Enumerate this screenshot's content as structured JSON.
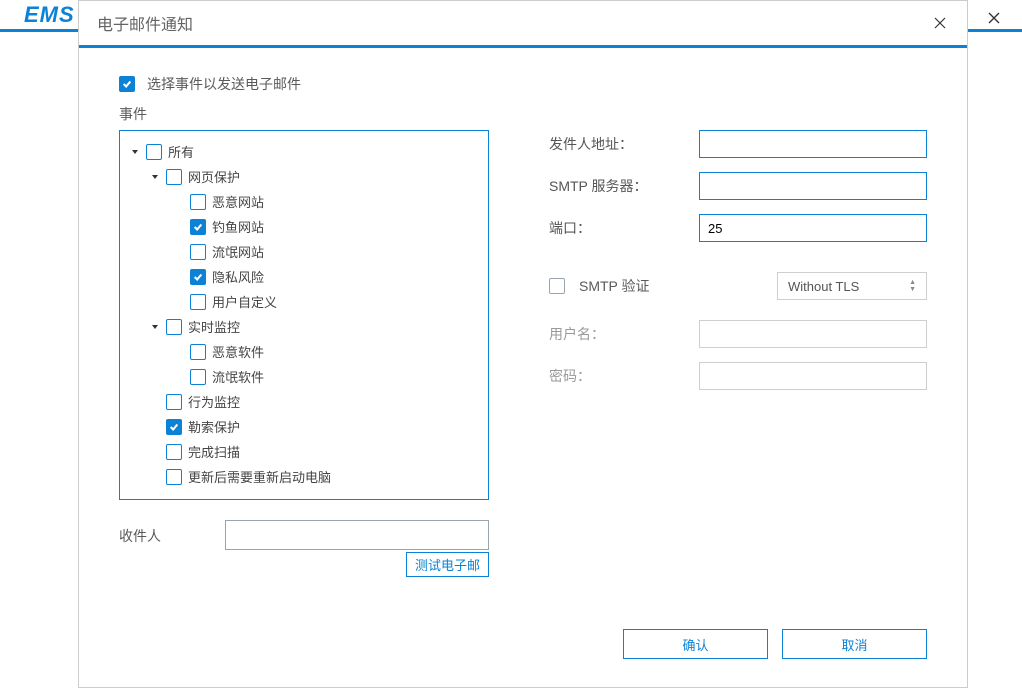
{
  "brand": "EMS",
  "modal": {
    "title": "电子邮件通知",
    "mainCheckbox": {
      "label": "选择事件以发送电子邮件",
      "checked": true
    },
    "eventsLabel": "事件",
    "tree": {
      "all": {
        "label": "所有",
        "checked": false
      },
      "webProtect": {
        "label": "网页保护",
        "checked": false
      },
      "badSite": {
        "label": "恶意网站",
        "checked": false
      },
      "phishing": {
        "label": "钓鱼网站",
        "checked": true
      },
      "rogueSite": {
        "label": "流氓网站",
        "checked": false
      },
      "privacy": {
        "label": "隐私风险",
        "checked": true
      },
      "userCustom": {
        "label": "用户自定义",
        "checked": false
      },
      "realtime": {
        "label": "实时监控",
        "checked": false
      },
      "malware": {
        "label": "恶意软件",
        "checked": false
      },
      "rogueSoft": {
        "label": "流氓软件",
        "checked": false
      },
      "behavior": {
        "label": "行为监控",
        "checked": false
      },
      "ransom": {
        "label": "勒索保护",
        "checked": true
      },
      "scanDone": {
        "label": "完成扫描",
        "checked": false
      },
      "updateRestart": {
        "label": "更新后需要重新启动电脑",
        "checked": false
      }
    },
    "recipientLabel": "收件人",
    "testEmail": "测试电子邮",
    "form": {
      "fromLabel": "发件人地址：",
      "fromValue": "",
      "smtpLabel": "SMTP 服务器：",
      "smtpValue": "",
      "portLabel": "端口：",
      "portValue": "25",
      "smtpAuthLabel": "SMTP 验证",
      "smtpAuthChecked": false,
      "tlsSelected": "Without TLS",
      "userLabel": "用户名：",
      "userValue": "",
      "passLabel": "密码：",
      "passValue": ""
    },
    "buttons": {
      "ok": "确认",
      "cancel": "取消"
    }
  }
}
